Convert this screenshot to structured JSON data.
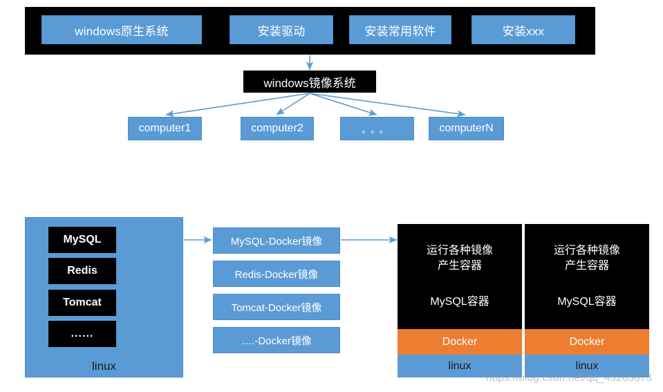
{
  "diagram": {
    "top_bar": {
      "steps": [
        {
          "label": "windows原生系统"
        },
        {
          "label": "安装驱动"
        },
        {
          "label": "安装常用软件"
        },
        {
          "label": "安装xxx"
        }
      ]
    },
    "mirror": {
      "label": "windows镜像系统"
    },
    "computers": [
      {
        "label": "computer1"
      },
      {
        "label": "computer2"
      },
      {
        "label": "。。。"
      },
      {
        "label": "computerN"
      }
    ],
    "host_panel": {
      "services": [
        {
          "label": "MySQL"
        },
        {
          "label": "Redis"
        },
        {
          "label": "Tomcat"
        },
        {
          "label": "......"
        }
      ],
      "os_label": "linux"
    },
    "docker_images": [
      {
        "label": "MySQL-Docker镜像"
      },
      {
        "label": "Redis-Docker镜像"
      },
      {
        "label": "Tomcat-Docker镜像"
      },
      {
        "label": "….-Docker镜像"
      }
    ],
    "containers": [
      {
        "run_line1": "运行各种镜像",
        "run_line2": "产生容器",
        "container_label": "MySQL容器",
        "docker_label": "Docker",
        "os_label": "linux"
      },
      {
        "run_line1": "运行各种镜像",
        "run_line2": "产生容器",
        "container_label": "MySQL容器",
        "docker_label": "Docker",
        "os_label": "linux"
      }
    ],
    "watermark": "https://blog.csdn.net/qq_43265673",
    "colors": {
      "blue": "#5B9BD5",
      "orange": "#ED7D31",
      "black": "#000000",
      "arrow": "#5B9BD5"
    }
  }
}
